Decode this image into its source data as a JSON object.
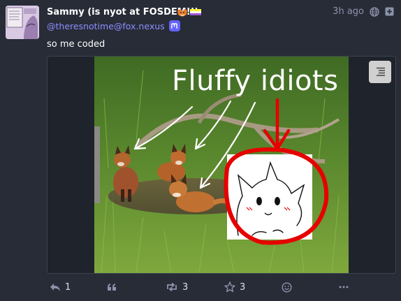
{
  "post": {
    "display_name": "Sammy (is nyot at FOSDEM!!)",
    "handle": "@theresnotime@fox.nexus",
    "timestamp": "3h ago",
    "text": "so me coded",
    "visibility_icon": "globe-icon",
    "extra_icon": "plus-square-icon",
    "name_emoji": [
      "fox-emoji",
      "nonbinary-flag-emoji"
    ]
  },
  "media": {
    "caption": "Fluffy idiots",
    "menu_icon": "menu-lines-icon"
  },
  "actions": {
    "reply_count": "1",
    "boost_count": "3",
    "favourite_count": "3"
  },
  "colors": {
    "background": "#282c37",
    "handle": "#8c8dff",
    "muted": "#8d93ab",
    "mastodon_brand": "#6364ff",
    "annotation_red": "#e60000"
  }
}
